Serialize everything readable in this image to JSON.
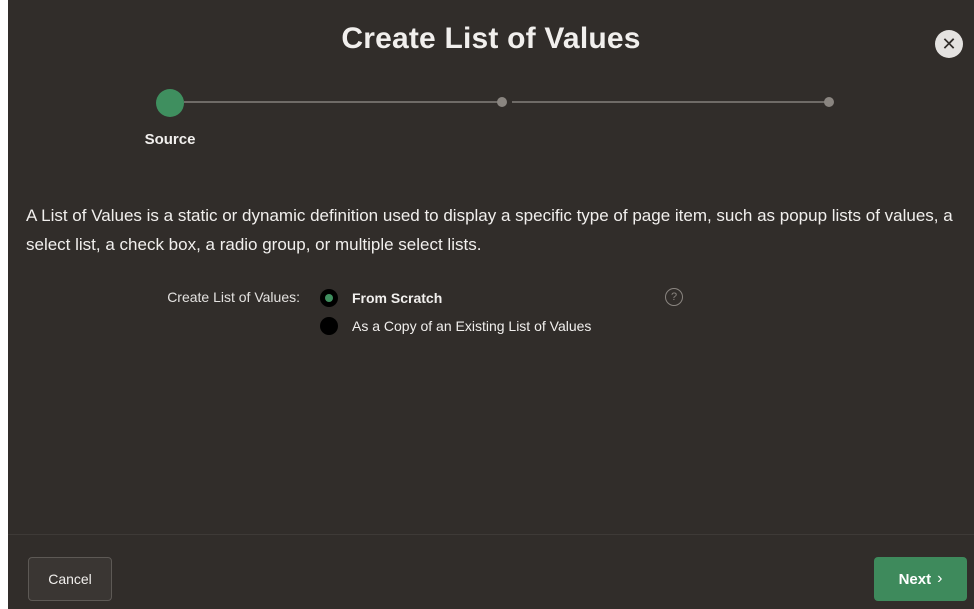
{
  "dialog": {
    "title": "Create List of Values",
    "close_icon": "close-icon"
  },
  "wizard": {
    "steps": [
      {
        "label": "Source",
        "state": "active"
      },
      {
        "label": "",
        "state": "pending"
      },
      {
        "label": "",
        "state": "pending"
      }
    ]
  },
  "description": "A List of Values is a static or dynamic definition used to display a specific type of page item, such as popup lists of values, a select list, a check box, a radio group, or multiple select lists.",
  "form": {
    "field_label": "Create List of Values:",
    "options": [
      {
        "label": "From Scratch",
        "selected": true
      },
      {
        "label": "As a Copy of an Existing List of Values",
        "selected": false
      }
    ],
    "help_icon": "help-icon"
  },
  "footer": {
    "cancel_label": "Cancel",
    "next_label": "Next",
    "next_icon": "chevron-right-icon"
  },
  "colors": {
    "background": "#312d2a",
    "accent": "#3e8a5c",
    "text": "#f1efed"
  }
}
